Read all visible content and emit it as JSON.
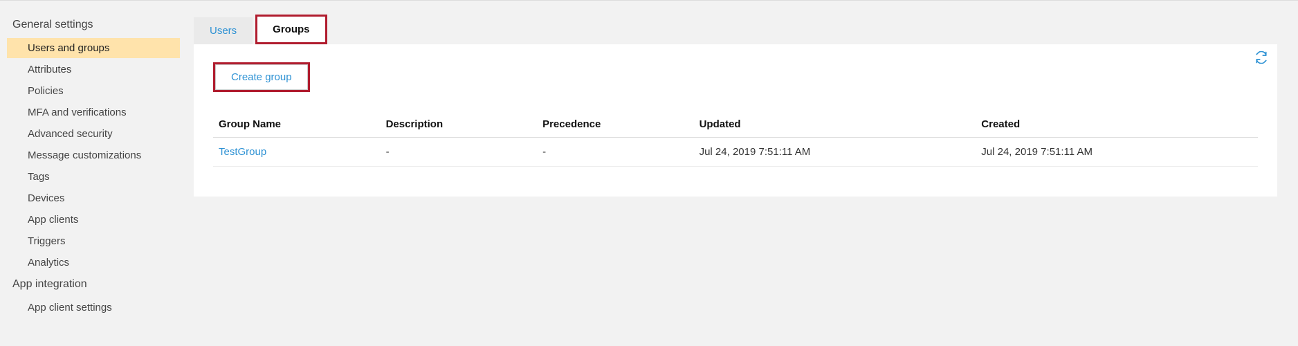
{
  "sidebar": {
    "sections": [
      {
        "heading": "General settings",
        "items": [
          {
            "label": "Users and groups",
            "selected": true
          },
          {
            "label": "Attributes",
            "selected": false
          },
          {
            "label": "Policies",
            "selected": false
          },
          {
            "label": "MFA and verifications",
            "selected": false
          },
          {
            "label": "Advanced security",
            "selected": false
          },
          {
            "label": "Message customizations",
            "selected": false
          },
          {
            "label": "Tags",
            "selected": false
          },
          {
            "label": "Devices",
            "selected": false
          },
          {
            "label": "App clients",
            "selected": false
          },
          {
            "label": "Triggers",
            "selected": false
          },
          {
            "label": "Analytics",
            "selected": false
          }
        ]
      },
      {
        "heading": "App integration",
        "items": [
          {
            "label": "App client settings",
            "selected": false
          }
        ]
      }
    ]
  },
  "tabs": [
    {
      "label": "Users",
      "active": false
    },
    {
      "label": "Groups",
      "active": true
    }
  ],
  "actions": {
    "create_group": "Create group"
  },
  "table": {
    "columns": [
      "Group Name",
      "Description",
      "Precedence",
      "Updated",
      "Created"
    ],
    "rows": [
      {
        "group_name": "TestGroup",
        "description": "-",
        "precedence": "-",
        "updated": "Jul 24, 2019 7:51:11 AM",
        "created": "Jul 24, 2019 7:51:11 AM"
      }
    ]
  }
}
